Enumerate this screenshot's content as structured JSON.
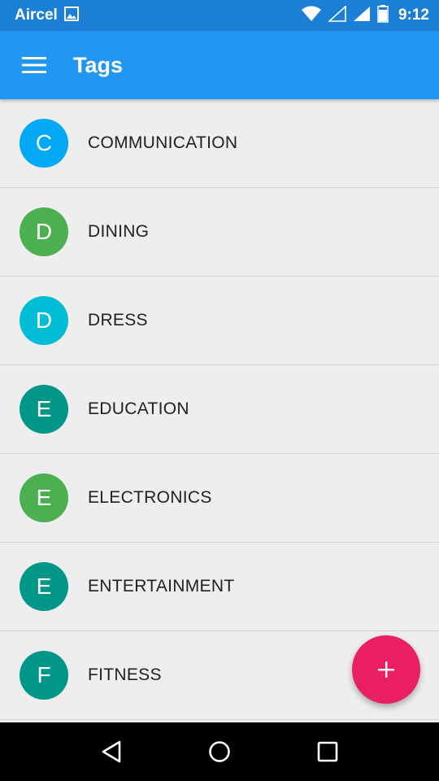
{
  "status_bar": {
    "carrier": "Aircel",
    "time": "9:12"
  },
  "app_bar": {
    "title": "Tags",
    "color": "#2196f3"
  },
  "tags": [
    {
      "letter": "C",
      "label": "COMMUNICATION",
      "color": "#03a9f4"
    },
    {
      "letter": "D",
      "label": "DINING",
      "color": "#4caf50"
    },
    {
      "letter": "D",
      "label": "DRESS",
      "color": "#00bcd4"
    },
    {
      "letter": "E",
      "label": "EDUCATION",
      "color": "#009688"
    },
    {
      "letter": "E",
      "label": "ELECTRONICS",
      "color": "#4caf50"
    },
    {
      "letter": "E",
      "label": "ENTERTAINMENT",
      "color": "#009688"
    },
    {
      "letter": "F",
      "label": "FITNESS",
      "color": "#009688"
    }
  ],
  "fab": {
    "icon": "plus-icon",
    "color": "#e91e63"
  },
  "nav_bar": {
    "icons": [
      "back-icon",
      "home-icon",
      "recents-icon"
    ]
  }
}
